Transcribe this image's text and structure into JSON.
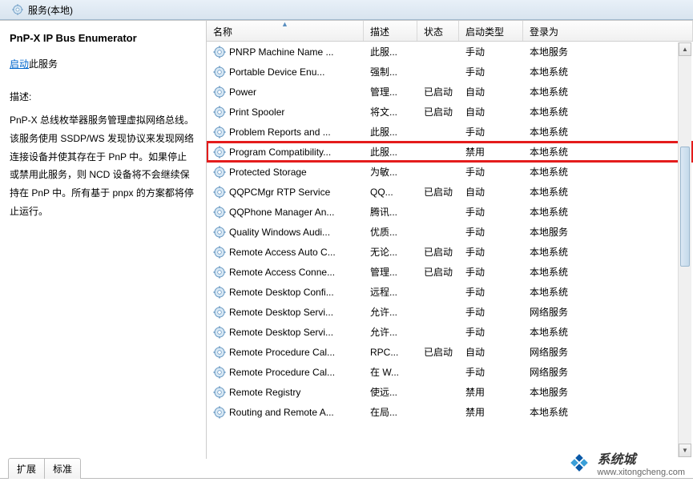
{
  "topbar": {
    "title": "服务(本地)"
  },
  "leftPanel": {
    "title": "PnP-X IP Bus Enumerator",
    "startLink": "启动",
    "startSuffix": "此服务",
    "descLabel": "描述:",
    "descText": "PnP-X 总线枚举器服务管理虚拟网络总线。该服务使用 SSDP/WS 发现协议来发现网络连接设备并使其存在于 PnP 中。如果停止或禁用此服务，则 NCD 设备将不会继续保持在 PnP 中。所有基于 pnpx 的方案都将停止运行。"
  },
  "columns": {
    "name": "名称",
    "desc": "描述",
    "status": "状态",
    "startType": "启动类型",
    "logon": "登录为"
  },
  "services": [
    {
      "name": "PNRP Machine Name ...",
      "desc": "此服...",
      "status": "",
      "start": "手动",
      "logon": "本地服务",
      "hl": false
    },
    {
      "name": "Portable Device Enu...",
      "desc": "强制...",
      "status": "",
      "start": "手动",
      "logon": "本地系统",
      "hl": false
    },
    {
      "name": "Power",
      "desc": "管理...",
      "status": "已启动",
      "start": "自动",
      "logon": "本地系统",
      "hl": false
    },
    {
      "name": "Print Spooler",
      "desc": "将文...",
      "status": "已启动",
      "start": "自动",
      "logon": "本地系统",
      "hl": false
    },
    {
      "name": "Problem Reports and ...",
      "desc": "此服...",
      "status": "",
      "start": "手动",
      "logon": "本地系统",
      "hl": false
    },
    {
      "name": "Program Compatibility...",
      "desc": "此服...",
      "status": "",
      "start": "禁用",
      "logon": "本地系统",
      "hl": true
    },
    {
      "name": "Protected Storage",
      "desc": "为敏...",
      "status": "",
      "start": "手动",
      "logon": "本地系统",
      "hl": false
    },
    {
      "name": "QQPCMgr RTP Service",
      "desc": "QQ...",
      "status": "已启动",
      "start": "自动",
      "logon": "本地系统",
      "hl": false
    },
    {
      "name": "QQPhone Manager An...",
      "desc": "腾讯...",
      "status": "",
      "start": "手动",
      "logon": "本地系统",
      "hl": false
    },
    {
      "name": "Quality Windows Audi...",
      "desc": "优质...",
      "status": "",
      "start": "手动",
      "logon": "本地服务",
      "hl": false
    },
    {
      "name": "Remote Access Auto C...",
      "desc": "无论...",
      "status": "已启动",
      "start": "手动",
      "logon": "本地系统",
      "hl": false
    },
    {
      "name": "Remote Access Conne...",
      "desc": "管理...",
      "status": "已启动",
      "start": "手动",
      "logon": "本地系统",
      "hl": false
    },
    {
      "name": "Remote Desktop Confi...",
      "desc": "远程...",
      "status": "",
      "start": "手动",
      "logon": "本地系统",
      "hl": false
    },
    {
      "name": "Remote Desktop Servi...",
      "desc": "允许...",
      "status": "",
      "start": "手动",
      "logon": "网络服务",
      "hl": false
    },
    {
      "name": "Remote Desktop Servi...",
      "desc": "允许...",
      "status": "",
      "start": "手动",
      "logon": "本地系统",
      "hl": false
    },
    {
      "name": "Remote Procedure Cal...",
      "desc": "RPC...",
      "status": "已启动",
      "start": "自动",
      "logon": "网络服务",
      "hl": false
    },
    {
      "name": "Remote Procedure Cal...",
      "desc": "在 W...",
      "status": "",
      "start": "手动",
      "logon": "网络服务",
      "hl": false
    },
    {
      "name": "Remote Registry",
      "desc": "使远...",
      "status": "",
      "start": "禁用",
      "logon": "本地服务",
      "hl": false
    },
    {
      "name": "Routing and Remote A...",
      "desc": "在局...",
      "status": "",
      "start": "禁用",
      "logon": "本地系统",
      "hl": false
    }
  ],
  "tabs": {
    "ext": "扩展",
    "std": "标准"
  },
  "watermark": {
    "name": "系统城",
    "url": "www.xitongcheng.com"
  }
}
